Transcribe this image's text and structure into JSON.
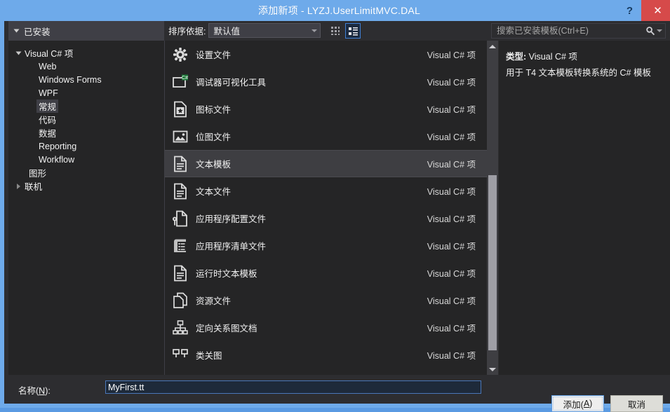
{
  "window": {
    "title": "添加新项 - LYZJ.UserLimitMVC.DAL",
    "help_label": "?",
    "close_label": "✕",
    "accent_color": "#6eaaea",
    "close_color": "#d64a4a",
    "background_color": "#2d2d30"
  },
  "toolbar": {
    "installed_header": "已安装",
    "sort_label": "排序依据:",
    "sort_value": "默认值",
    "grid_view_icon": "grid-view-icon",
    "list_view_icon": "list-view-icon",
    "search_placeholder": "搜索已安装模板(Ctrl+E)",
    "search_value": "",
    "search_icon": "search-icon"
  },
  "sidebar": {
    "nodes": [
      {
        "label": "Visual C# 项",
        "level": 0,
        "expanded": true,
        "has_twist": true,
        "selected": false
      },
      {
        "label": "Web",
        "level": 1,
        "expanded": false,
        "has_twist": false,
        "selected": false
      },
      {
        "label": "Windows Forms",
        "level": 1,
        "expanded": false,
        "has_twist": false,
        "selected": false
      },
      {
        "label": "WPF",
        "level": 1,
        "expanded": false,
        "has_twist": false,
        "selected": false
      },
      {
        "label": "常规",
        "level": 1,
        "expanded": false,
        "has_twist": false,
        "selected": true
      },
      {
        "label": "代码",
        "level": 1,
        "expanded": false,
        "has_twist": false,
        "selected": false
      },
      {
        "label": "数据",
        "level": 1,
        "expanded": false,
        "has_twist": false,
        "selected": false
      },
      {
        "label": "Reporting",
        "level": 1,
        "expanded": false,
        "has_twist": false,
        "selected": false
      },
      {
        "label": "Workflow",
        "level": 1,
        "expanded": false,
        "has_twist": false,
        "selected": false
      },
      {
        "label": "图形",
        "level": 0,
        "expanded": false,
        "has_twist": false,
        "selected": false
      },
      {
        "label": "联机",
        "level": 0,
        "expanded": false,
        "has_twist": true,
        "selected": false
      }
    ]
  },
  "list": {
    "type_column": "Visual C# 项",
    "items": [
      {
        "name": "设置文件",
        "type": "Visual C# 项",
        "icon": "gear-icon",
        "selected": false
      },
      {
        "name": "调试器可视化工具",
        "type": "Visual C# 项",
        "icon": "debugger-visualizer-icon",
        "selected": false
      },
      {
        "name": "图标文件",
        "type": "Visual C# 项",
        "icon": "icon-file-icon",
        "selected": false
      },
      {
        "name": "位图文件",
        "type": "Visual C# 项",
        "icon": "bitmap-file-icon",
        "selected": false
      },
      {
        "name": "文本模板",
        "type": "Visual C# 项",
        "icon": "text-template-icon",
        "selected": true
      },
      {
        "name": "文本文件",
        "type": "Visual C# 项",
        "icon": "text-file-icon",
        "selected": false
      },
      {
        "name": "应用程序配置文件",
        "type": "Visual C# 项",
        "icon": "app-config-icon",
        "selected": false
      },
      {
        "name": "应用程序清单文件",
        "type": "Visual C# 项",
        "icon": "app-manifest-icon",
        "selected": false
      },
      {
        "name": "运行时文本模板",
        "type": "Visual C# 项",
        "icon": "runtime-text-template-icon",
        "selected": false
      },
      {
        "name": "资源文件",
        "type": "Visual C# 项",
        "icon": "resource-file-icon",
        "selected": false
      },
      {
        "name": "定向关系图文档",
        "type": "Visual C# 项",
        "icon": "directed-graph-icon",
        "selected": false
      },
      {
        "name": "类关图",
        "type": "Visual C# 项",
        "icon": "class-diagram-icon",
        "selected": false
      }
    ]
  },
  "info": {
    "type_label": "类型:",
    "type_value": "Visual C# 项",
    "description": "用于 T4 文本模板转换系统的 C# 模板"
  },
  "bottom": {
    "name_label_prefix": "名称(",
    "name_label_key": "N",
    "name_label_suffix": "):",
    "name_value": "MyFirst.tt",
    "add_prefix": "添加(",
    "add_key": "A",
    "add_suffix": ")",
    "cancel_label": "取消"
  }
}
